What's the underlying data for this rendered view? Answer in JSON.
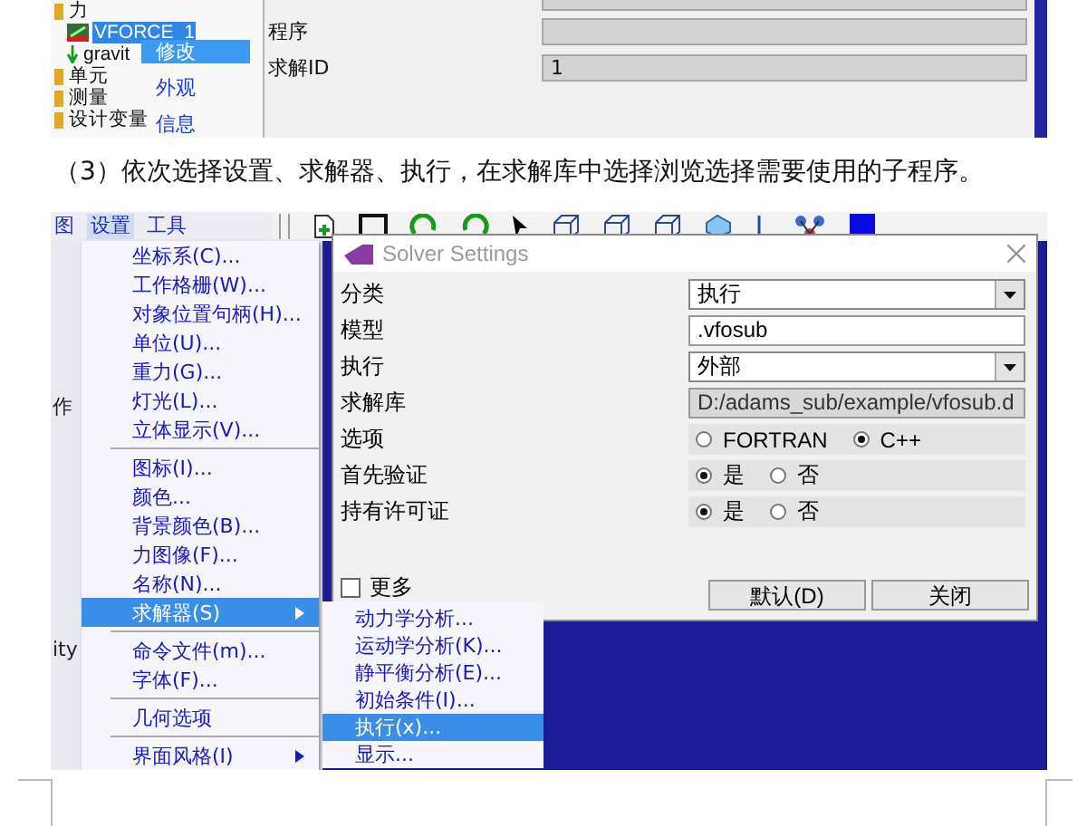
{
  "top_screenshot": {
    "tree": [
      {
        "label": "力",
        "kind": "folder",
        "selected": false,
        "children": [
          {
            "label": "VFORCE_1",
            "kind": "force",
            "selected": true
          },
          {
            "label": "gravit",
            "kind": "gravity",
            "selected": false
          }
        ]
      },
      {
        "label": "单元",
        "kind": "folder",
        "selected": false
      },
      {
        "label": "测量",
        "kind": "folder",
        "selected": false
      },
      {
        "label": "设计变量",
        "kind": "folder",
        "selected": false
      }
    ],
    "context_menu": [
      {
        "label": "修改",
        "selected": true
      },
      {
        "label": "外观",
        "selected": false
      },
      {
        "label": "信息",
        "selected": false
      }
    ],
    "properties": [
      {
        "label": "程序"
      },
      {
        "label": "求解ID",
        "value": "1"
      }
    ]
  },
  "caption": "（3）依次选择设置、求解器、执行，在求解库中选择浏览选择需要使用的子程序。",
  "bottom_screenshot": {
    "menubar": [
      {
        "label": "图",
        "selected": false
      },
      {
        "label": "设置",
        "selected": true
      },
      {
        "label": "工具",
        "selected": false
      }
    ],
    "background_fragments": [
      "作",
      "ity"
    ],
    "settings_menu": [
      {
        "kind": "item",
        "label": "坐标系(C)...",
        "selected": false,
        "has_submenu": false
      },
      {
        "kind": "item",
        "label": "工作格栅(W)...",
        "selected": false,
        "has_submenu": false
      },
      {
        "kind": "item",
        "label": "对象位置句柄(H)...",
        "selected": false,
        "has_submenu": false
      },
      {
        "kind": "item",
        "label": "单位(U)...",
        "selected": false,
        "has_submenu": false
      },
      {
        "kind": "item",
        "label": "重力(G)...",
        "selected": false,
        "has_submenu": false
      },
      {
        "kind": "item",
        "label": "灯光(L)...",
        "selected": false,
        "has_submenu": false
      },
      {
        "kind": "item",
        "label": "立体显示(V)...",
        "selected": false,
        "has_submenu": false
      },
      {
        "kind": "separator"
      },
      {
        "kind": "item",
        "label": "图标(I)...",
        "selected": false,
        "has_submenu": false
      },
      {
        "kind": "item",
        "label": "颜色...",
        "selected": false,
        "has_submenu": false
      },
      {
        "kind": "item",
        "label": "背景颜色(B)...",
        "selected": false,
        "has_submenu": false
      },
      {
        "kind": "item",
        "label": "力图像(F)...",
        "selected": false,
        "has_submenu": false
      },
      {
        "kind": "item",
        "label": "名称(N)...",
        "selected": false,
        "has_submenu": false
      },
      {
        "kind": "item",
        "label": "求解器(S)",
        "selected": true,
        "has_submenu": true
      },
      {
        "kind": "separator"
      },
      {
        "kind": "item",
        "label": "命令文件(m)...",
        "selected": false,
        "has_submenu": false
      },
      {
        "kind": "item",
        "label": "字体(F)...",
        "selected": false,
        "has_submenu": false
      },
      {
        "kind": "separator"
      },
      {
        "kind": "item",
        "label": "几何选项",
        "selected": false,
        "has_submenu": false
      },
      {
        "kind": "separator"
      },
      {
        "kind": "item",
        "label": "界面风格(I)",
        "selected": false,
        "has_submenu": true
      }
    ],
    "solver_submenu": [
      {
        "label": "动力学分析...",
        "selected": false
      },
      {
        "label": "运动学分析(K)...",
        "selected": false
      },
      {
        "label": "静平衡分析(E)...",
        "selected": false
      },
      {
        "label": "初始条件(I)...",
        "selected": false
      },
      {
        "label": "执行(x)...",
        "selected": true
      },
      {
        "label": "显示...",
        "selected": false
      }
    ],
    "dialog": {
      "title": "Solver Settings",
      "rows": [
        {
          "kind": "dropdown",
          "label": "分类",
          "value": "执行"
        },
        {
          "kind": "field",
          "label": "模型",
          "value": ".vfosub",
          "disabled": false
        },
        {
          "kind": "dropdown",
          "label": "执行",
          "value": "外部"
        },
        {
          "kind": "field",
          "label": "求解库",
          "value": "D:/adams_sub/example/vfosub.d",
          "disabled": true
        },
        {
          "kind": "radio",
          "label": "选项",
          "options": [
            {
              "label": "FORTRAN",
              "selected": false
            },
            {
              "label": "C++",
              "selected": true
            }
          ]
        },
        {
          "kind": "radio",
          "label": "首先验证",
          "options": [
            {
              "label": "是",
              "selected": true
            },
            {
              "label": "否",
              "selected": false
            }
          ]
        },
        {
          "kind": "radio",
          "label": "持有许可证",
          "options": [
            {
              "label": "是",
              "selected": true
            },
            {
              "label": "否",
              "selected": false
            }
          ]
        }
      ],
      "more": {
        "label": "更多",
        "checked": false
      },
      "buttons": [
        "默认(D)",
        "关闭"
      ]
    }
  }
}
